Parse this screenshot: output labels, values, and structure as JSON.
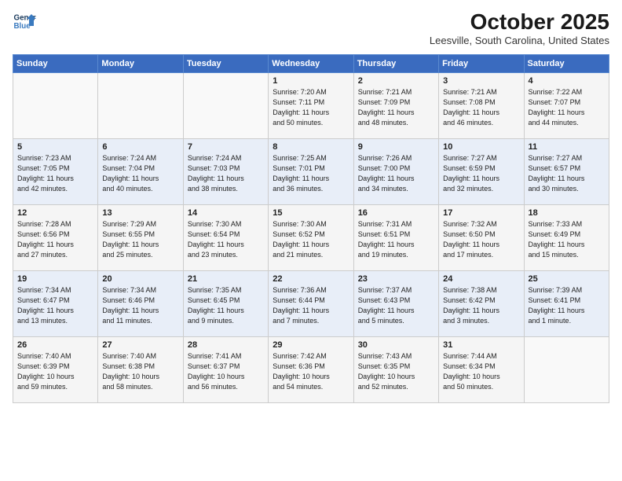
{
  "logo": {
    "line1": "General",
    "line2": "Blue"
  },
  "title": "October 2025",
  "location": "Leesville, South Carolina, United States",
  "days_header": [
    "Sunday",
    "Monday",
    "Tuesday",
    "Wednesday",
    "Thursday",
    "Friday",
    "Saturday"
  ],
  "weeks": [
    [
      {
        "num": "",
        "info": ""
      },
      {
        "num": "",
        "info": ""
      },
      {
        "num": "",
        "info": ""
      },
      {
        "num": "1",
        "info": "Sunrise: 7:20 AM\nSunset: 7:11 PM\nDaylight: 11 hours\nand 50 minutes."
      },
      {
        "num": "2",
        "info": "Sunrise: 7:21 AM\nSunset: 7:09 PM\nDaylight: 11 hours\nand 48 minutes."
      },
      {
        "num": "3",
        "info": "Sunrise: 7:21 AM\nSunset: 7:08 PM\nDaylight: 11 hours\nand 46 minutes."
      },
      {
        "num": "4",
        "info": "Sunrise: 7:22 AM\nSunset: 7:07 PM\nDaylight: 11 hours\nand 44 minutes."
      }
    ],
    [
      {
        "num": "5",
        "info": "Sunrise: 7:23 AM\nSunset: 7:05 PM\nDaylight: 11 hours\nand 42 minutes."
      },
      {
        "num": "6",
        "info": "Sunrise: 7:24 AM\nSunset: 7:04 PM\nDaylight: 11 hours\nand 40 minutes."
      },
      {
        "num": "7",
        "info": "Sunrise: 7:24 AM\nSunset: 7:03 PM\nDaylight: 11 hours\nand 38 minutes."
      },
      {
        "num": "8",
        "info": "Sunrise: 7:25 AM\nSunset: 7:01 PM\nDaylight: 11 hours\nand 36 minutes."
      },
      {
        "num": "9",
        "info": "Sunrise: 7:26 AM\nSunset: 7:00 PM\nDaylight: 11 hours\nand 34 minutes."
      },
      {
        "num": "10",
        "info": "Sunrise: 7:27 AM\nSunset: 6:59 PM\nDaylight: 11 hours\nand 32 minutes."
      },
      {
        "num": "11",
        "info": "Sunrise: 7:27 AM\nSunset: 6:57 PM\nDaylight: 11 hours\nand 30 minutes."
      }
    ],
    [
      {
        "num": "12",
        "info": "Sunrise: 7:28 AM\nSunset: 6:56 PM\nDaylight: 11 hours\nand 27 minutes."
      },
      {
        "num": "13",
        "info": "Sunrise: 7:29 AM\nSunset: 6:55 PM\nDaylight: 11 hours\nand 25 minutes."
      },
      {
        "num": "14",
        "info": "Sunrise: 7:30 AM\nSunset: 6:54 PM\nDaylight: 11 hours\nand 23 minutes."
      },
      {
        "num": "15",
        "info": "Sunrise: 7:30 AM\nSunset: 6:52 PM\nDaylight: 11 hours\nand 21 minutes."
      },
      {
        "num": "16",
        "info": "Sunrise: 7:31 AM\nSunset: 6:51 PM\nDaylight: 11 hours\nand 19 minutes."
      },
      {
        "num": "17",
        "info": "Sunrise: 7:32 AM\nSunset: 6:50 PM\nDaylight: 11 hours\nand 17 minutes."
      },
      {
        "num": "18",
        "info": "Sunrise: 7:33 AM\nSunset: 6:49 PM\nDaylight: 11 hours\nand 15 minutes."
      }
    ],
    [
      {
        "num": "19",
        "info": "Sunrise: 7:34 AM\nSunset: 6:47 PM\nDaylight: 11 hours\nand 13 minutes."
      },
      {
        "num": "20",
        "info": "Sunrise: 7:34 AM\nSunset: 6:46 PM\nDaylight: 11 hours\nand 11 minutes."
      },
      {
        "num": "21",
        "info": "Sunrise: 7:35 AM\nSunset: 6:45 PM\nDaylight: 11 hours\nand 9 minutes."
      },
      {
        "num": "22",
        "info": "Sunrise: 7:36 AM\nSunset: 6:44 PM\nDaylight: 11 hours\nand 7 minutes."
      },
      {
        "num": "23",
        "info": "Sunrise: 7:37 AM\nSunset: 6:43 PM\nDaylight: 11 hours\nand 5 minutes."
      },
      {
        "num": "24",
        "info": "Sunrise: 7:38 AM\nSunset: 6:42 PM\nDaylight: 11 hours\nand 3 minutes."
      },
      {
        "num": "25",
        "info": "Sunrise: 7:39 AM\nSunset: 6:41 PM\nDaylight: 11 hours\nand 1 minute."
      }
    ],
    [
      {
        "num": "26",
        "info": "Sunrise: 7:40 AM\nSunset: 6:39 PM\nDaylight: 10 hours\nand 59 minutes."
      },
      {
        "num": "27",
        "info": "Sunrise: 7:40 AM\nSunset: 6:38 PM\nDaylight: 10 hours\nand 58 minutes."
      },
      {
        "num": "28",
        "info": "Sunrise: 7:41 AM\nSunset: 6:37 PM\nDaylight: 10 hours\nand 56 minutes."
      },
      {
        "num": "29",
        "info": "Sunrise: 7:42 AM\nSunset: 6:36 PM\nDaylight: 10 hours\nand 54 minutes."
      },
      {
        "num": "30",
        "info": "Sunrise: 7:43 AM\nSunset: 6:35 PM\nDaylight: 10 hours\nand 52 minutes."
      },
      {
        "num": "31",
        "info": "Sunrise: 7:44 AM\nSunset: 6:34 PM\nDaylight: 10 hours\nand 50 minutes."
      },
      {
        "num": "",
        "info": ""
      }
    ]
  ]
}
